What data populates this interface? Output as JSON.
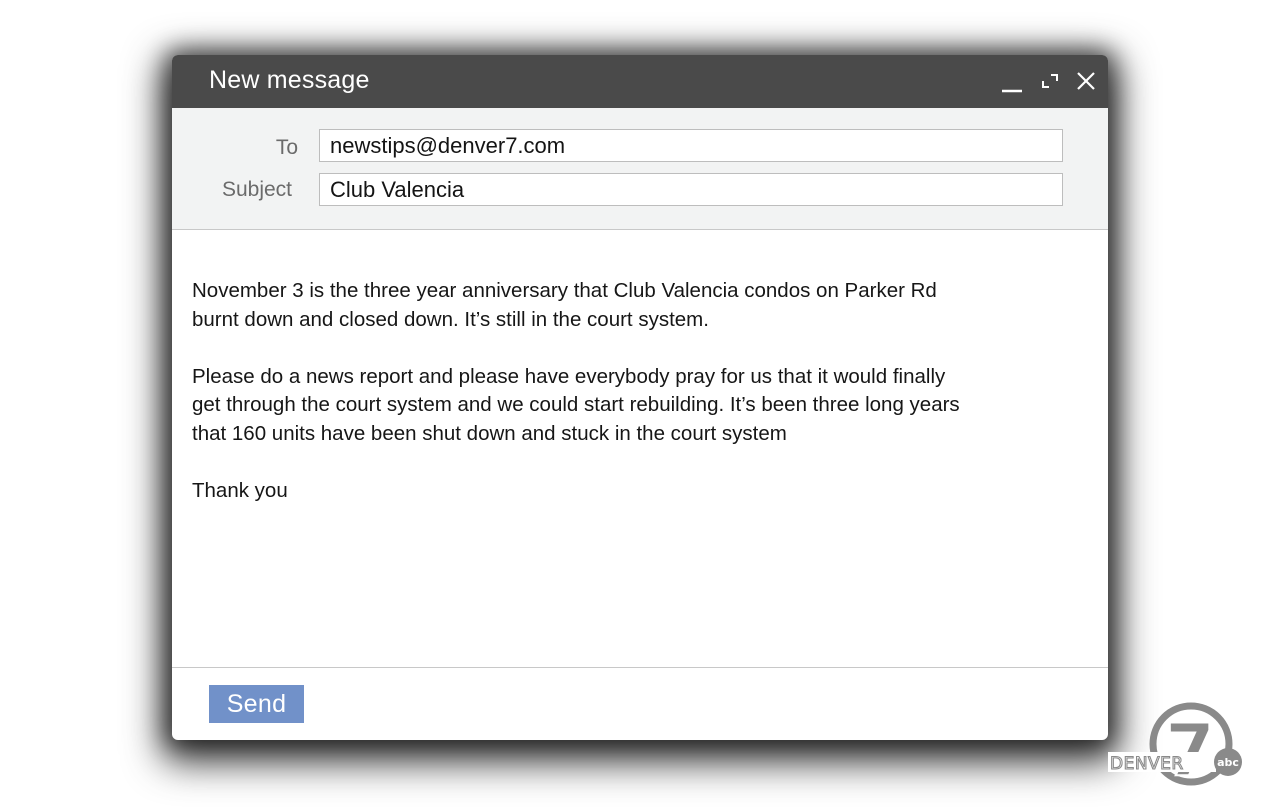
{
  "window": {
    "title": "New message",
    "controls": {
      "minimize_icon": "minimize-icon",
      "expand_icon": "expand-icon",
      "close_icon": "close-icon"
    }
  },
  "fields": {
    "to_label": "To",
    "to_value": "newstips@denver7.com",
    "subject_label": "Subject",
    "subject_value": "Club Valencia"
  },
  "body": {
    "paragraphs": [
      "November 3 is the three year anniversary that Club Valencia condos on Parker Rd\nburnt down and closed down. It’s still in the court system.",
      "Please do a news report and please have everybody pray for us that it would finally\nget through the court system and we could start rebuilding. It’s been three long years\nthat 160 units have been shut down and stuck in the court system",
      "Thank you"
    ]
  },
  "footer": {
    "send_label": "Send"
  },
  "logo": {
    "text": "DENVER",
    "number": "7",
    "network": "abc"
  },
  "colors": {
    "titlebar": "#4a4a4a",
    "header_bg": "#f2f3f3",
    "send_button": "#7191c9",
    "logo_gray": "#8a8a8a"
  }
}
